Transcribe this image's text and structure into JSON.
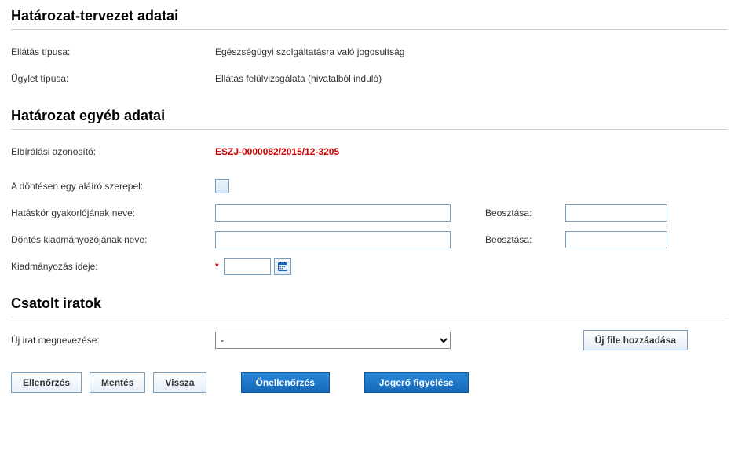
{
  "section_draft": {
    "title": "Határozat-tervezet adatai",
    "benefit_type_label": "Ellátás típusa:",
    "benefit_type_value": "Egészségügyi szolgáltatásra való jogosultság",
    "transaction_type_label": "Ügylet típusa:",
    "transaction_type_value": "Ellátás felülvizsgálata (hivatalból induló)"
  },
  "section_other": {
    "title": "Határozat egyéb adatai",
    "assessment_id_label": "Elbírálási azonosító:",
    "assessment_id_value": "ESZJ-0000082/2015/12-3205",
    "single_signer_label": "A döntésen egy aláíró szerepel:",
    "authority_name_label": "Hatáskör gyakorlójának neve:",
    "authority_name_value": "",
    "authority_position_label": "Beosztása:",
    "authority_position_value": "",
    "dispatcher_name_label": "Döntés kiadmányozójának neve:",
    "dispatcher_name_value": "",
    "dispatcher_position_label": "Beosztása:",
    "dispatcher_position_value": "",
    "dispatch_time_label": "Kiadmányozás ideje:",
    "dispatch_time_value": ""
  },
  "section_attachments": {
    "title": "Csatolt iratok",
    "new_doc_label": "Új irat megnevezése:",
    "new_doc_selected": "-",
    "add_file_button": "Új file hozzáadása"
  },
  "buttons": {
    "check": "Ellenőrzés",
    "save": "Mentés",
    "back": "Vissza",
    "self_check": "Önellenőrzés",
    "finality_watch": "Jogerő figyelése"
  }
}
